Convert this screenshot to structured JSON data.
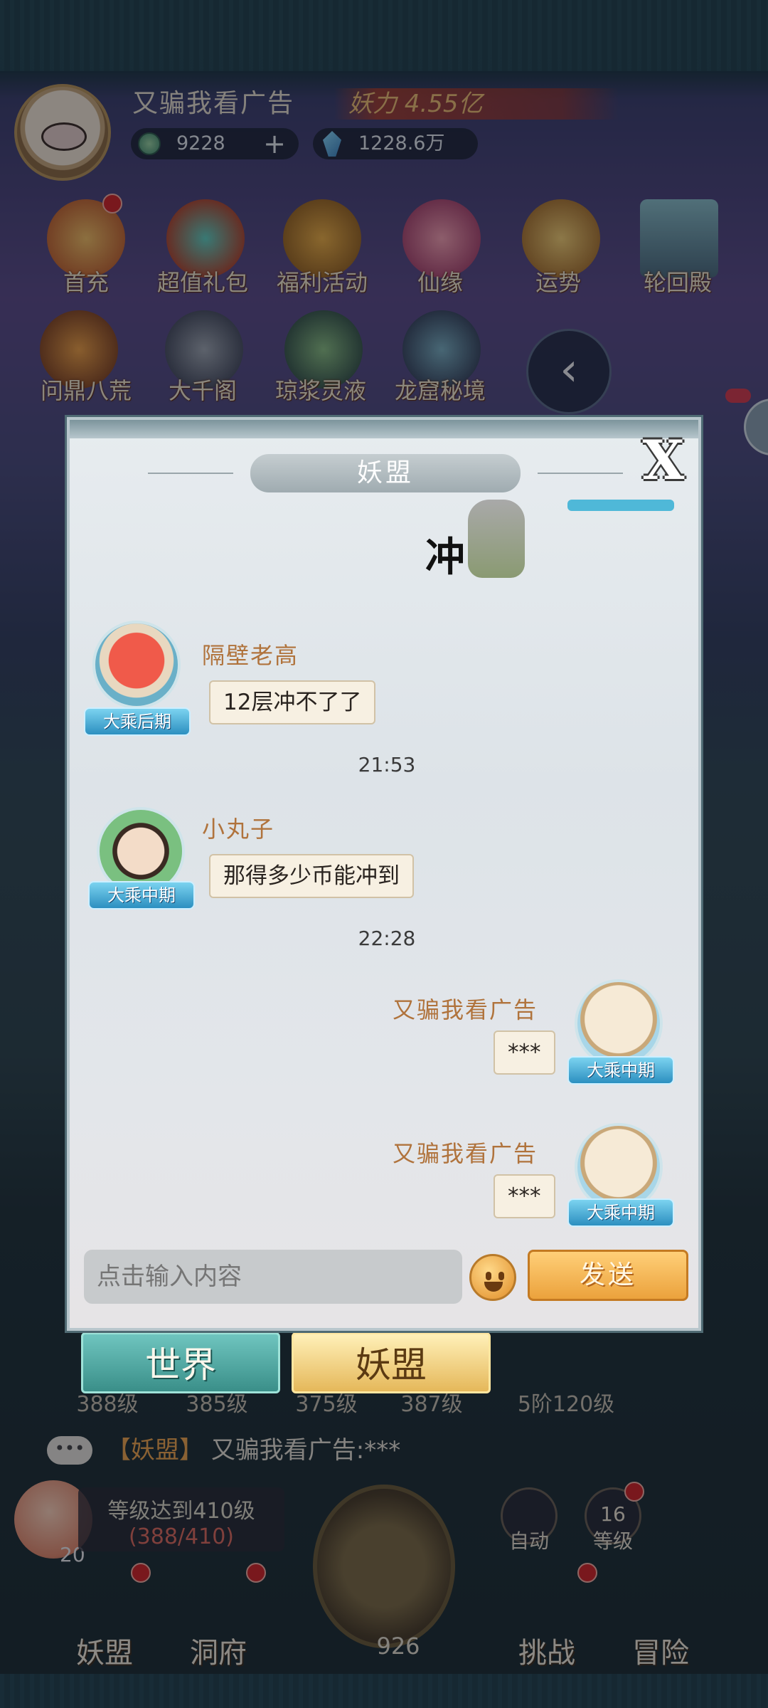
{
  "header": {
    "player_name": "又骗我看广告",
    "power_label": "妖力 4.55亿",
    "coins": "9228",
    "gems": "1228.6万"
  },
  "menu": {
    "row1": [
      "首充",
      "超值礼包",
      "福利活动",
      "仙缘",
      "运势",
      "轮回殿"
    ],
    "row2": [
      "问鼎八荒",
      "大千阁",
      "琼浆灵液",
      "龙窟秘境"
    ],
    "collapse_glyph": "‹"
  },
  "dialog": {
    "title": "妖盟",
    "close_glyph": "X",
    "sticker_text": "冲",
    "messages": [
      {
        "side": "left",
        "name": "隔壁老高",
        "rank": "大乘后期",
        "text": "12层冲不了了"
      },
      {
        "side": "left",
        "name": "小丸子",
        "rank": "大乘中期",
        "text": "那得多少币能冲到"
      },
      {
        "side": "right",
        "name": "又骗我看广告",
        "rank": "大乘中期",
        "text": "***"
      },
      {
        "side": "right",
        "name": "又骗我看广告",
        "rank": "大乘中期",
        "text": "***"
      }
    ],
    "timestamps": [
      "21:53",
      "22:28"
    ],
    "input_placeholder": "点击输入内容",
    "send_label": "发送"
  },
  "tabs": {
    "world": "世界",
    "alliance": "妖盟"
  },
  "background_levels": [
    "388级",
    "385级",
    "375级",
    "387级",
    "5阶120级"
  ],
  "chat_preview": {
    "bubble": "•••",
    "tag": "【妖盟】",
    "text": "又骗我看广告:***"
  },
  "level_goal": {
    "line1": "等级达到410级",
    "progress": "(388/410)"
  },
  "peach_count": "20",
  "axe_count": "926",
  "auto_label": "自动",
  "level_label": "等级",
  "level_value": "16",
  "bottom_nav": [
    "妖盟",
    "洞府",
    "挑战",
    "冒险"
  ],
  "colors": {
    "name_brown": "#b0733c",
    "send_orange": "#eba23c",
    "rank_blue": "#2c8fc0",
    "tab_teal": "#3a8f89",
    "tab_gold": "#e5b85a"
  }
}
